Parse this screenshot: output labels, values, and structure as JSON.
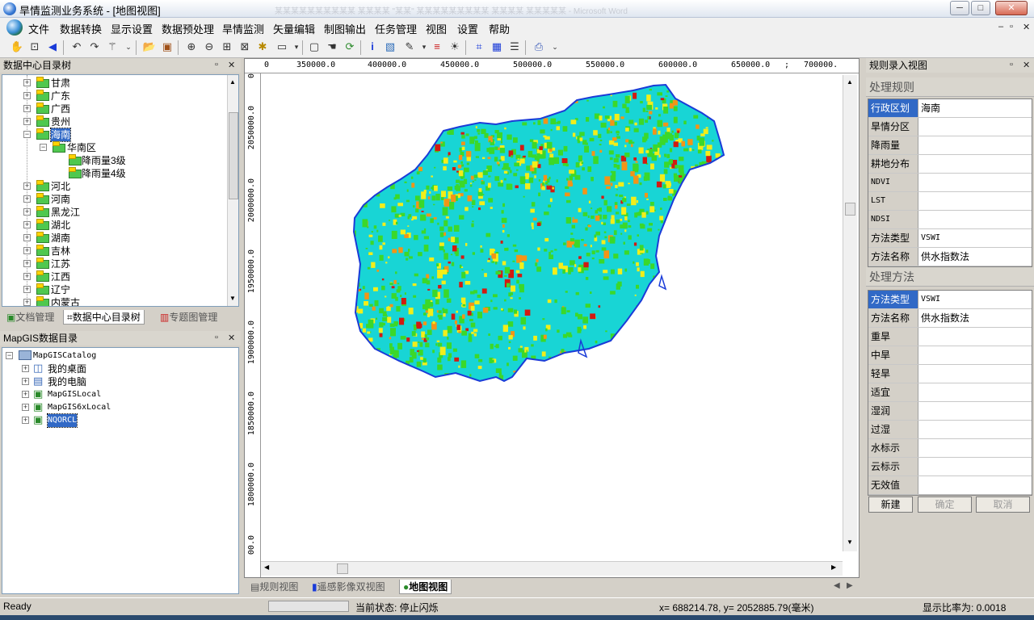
{
  "window": {
    "title": "旱情监测业务系统 - [地图视图]",
    "bg_title": "某某某某某某某某某某 某某某某 \"某某\" 某某某某某某某某某 某某某某 某某某某某 - Microsoft Word",
    "min": "─",
    "max": "□",
    "close": "✕"
  },
  "menu": {
    "items": [
      "文件",
      "数据转换",
      "显示设置",
      "数据预处理",
      "旱情监测",
      "矢量编辑",
      "制图输出",
      "任务管理",
      "视图",
      "设置",
      "帮助"
    ],
    "mdi": [
      "–",
      "▫",
      "✕"
    ]
  },
  "toolbar": {
    "icons": [
      "pan-hand",
      "full-extent",
      "back",
      "undo-rotate",
      "redo-rotate",
      "magic-wand",
      "open-folder",
      "save",
      "zoom-in",
      "zoom-out",
      "zoom-box",
      "zoom-fit",
      "select-box",
      "frame",
      "hand",
      "refresh",
      "info",
      "layer-image",
      "draw-pen",
      "color-bar",
      "brightness",
      "grid",
      "table",
      "list",
      "print"
    ]
  },
  "left_top": {
    "title": "数据中心目录树",
    "pin": "▫",
    "close": "✕",
    "nodes": [
      {
        "label": "甘肃"
      },
      {
        "label": "广东"
      },
      {
        "label": "广西"
      },
      {
        "label": "贵州"
      },
      {
        "label": "海南"
      },
      {
        "label": "华南区"
      },
      {
        "label": "降雨量3级"
      },
      {
        "label": "降雨量4级"
      },
      {
        "label": "河北"
      },
      {
        "label": "河南"
      },
      {
        "label": "黑龙江"
      },
      {
        "label": "湖北"
      },
      {
        "label": "湖南"
      },
      {
        "label": "吉林"
      },
      {
        "label": "江苏"
      },
      {
        "label": "江西"
      },
      {
        "label": "辽宁"
      },
      {
        "label": "内蒙古"
      }
    ],
    "tabs": [
      {
        "label": "文档管理"
      },
      {
        "label": "数据中心目录树"
      },
      {
        "label": "专题图管理"
      }
    ]
  },
  "left_bottom": {
    "title": "MapGIS数据目录",
    "pin": "▫",
    "close": "✕",
    "nodes": [
      {
        "label": "MapGISCatalog"
      },
      {
        "label": "我的桌面"
      },
      {
        "label": "我的电脑"
      },
      {
        "label": "MapGISLocal"
      },
      {
        "label": "MapGIS6xLocal"
      },
      {
        "label": "NQORCL"
      }
    ]
  },
  "map": {
    "ruler_top": [
      "0",
      "350000.0",
      "400000.0",
      "450000.0",
      "500000.0",
      "550000.0",
      "600000.0",
      "650000.0",
      ";",
      "700000."
    ],
    "ruler_left": [
      "0",
      "2050000.0",
      "2000000.0",
      "1950000.0",
      "1900000.0",
      "1850000.0",
      "1800000.0",
      "00.0"
    ],
    "colors": {
      "base": "#18d5d5",
      "green": "#3bd82a",
      "yellow": "#f2ee1a",
      "orange": "#f29418",
      "red": "#d21a12",
      "border": "#1a3bd8"
    },
    "tabs": [
      {
        "label": "规则视图"
      },
      {
        "label": "遥感影像双视图"
      },
      {
        "label": "地图视图"
      }
    ]
  },
  "rule_panel": {
    "title": "规则录入视图",
    "pin": "▫",
    "close": "✕",
    "section1": "处理规则",
    "rules": [
      {
        "key": "行政区划",
        "value": "海南"
      },
      {
        "key": "旱情分区",
        "value": ""
      },
      {
        "key": "降雨量",
        "value": ""
      },
      {
        "key": "耕地分布",
        "value": ""
      },
      {
        "key": "NDVI",
        "value": ""
      },
      {
        "key": "LST",
        "value": ""
      },
      {
        "key": "NDSI",
        "value": ""
      },
      {
        "key": "方法类型",
        "value": "VSWI"
      },
      {
        "key": "方法名称",
        "value": "供水指数法"
      }
    ],
    "section2": "处理方法",
    "methods": [
      {
        "key": "方法类型",
        "value": "VSWI"
      },
      {
        "key": "方法名称",
        "value": "供水指数法"
      },
      {
        "key": "重旱",
        "value": ""
      },
      {
        "key": "中旱",
        "value": ""
      },
      {
        "key": "轻旱",
        "value": ""
      },
      {
        "key": "适宜",
        "value": ""
      },
      {
        "key": "湿润",
        "value": ""
      },
      {
        "key": "过湿",
        "value": ""
      },
      {
        "key": "水标示",
        "value": ""
      },
      {
        "key": "云标示",
        "value": ""
      },
      {
        "key": "无效值",
        "value": ""
      }
    ],
    "buttons": {
      "new": "新建",
      "ok": "确定",
      "cancel": "取消"
    }
  },
  "status": {
    "ready": "Ready",
    "state": "当前状态: 停止闪烁",
    "coords": "x= 688214.78, y= 2052885.79(毫米)",
    "scale": "显示比率为:  0.0018"
  }
}
